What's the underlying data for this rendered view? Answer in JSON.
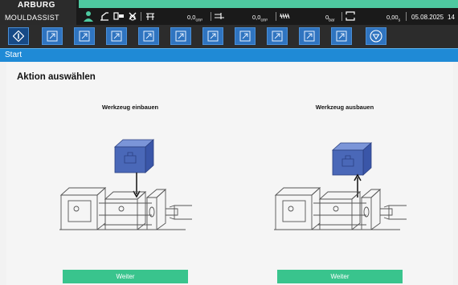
{
  "header": {
    "brand": "ARBURG",
    "app_name": "MOULDASSIST",
    "status": {
      "injection_volume": "0,0",
      "injection_unit": "cm³",
      "dosing_volume": "0,0",
      "dosing_unit": "cm³",
      "pressure": "0",
      "pressure_unit": "bar",
      "cycle_time": "0,00",
      "cycle_unit": "s",
      "date": "05.08.2025",
      "time": "14"
    },
    "status_icons": [
      "operator-icon",
      "robot-arm-icon",
      "door-icon",
      "no-alarm-icon",
      "tool-icon"
    ]
  },
  "toolbar": {
    "start_icon": "start-diamond-icon",
    "buttons": [
      "export-icon",
      "export-icon",
      "export-icon",
      "export-icon",
      "export-icon",
      "export-icon",
      "export-icon",
      "export-icon",
      "export-icon",
      "export-icon"
    ],
    "down_icon": "triangle-down-icon"
  },
  "breadcrumb": {
    "label": "Start"
  },
  "main": {
    "title": "Aktion auswählen",
    "options": [
      {
        "label": "Werkzeug einbauen",
        "button": "Weiter",
        "direction": "down"
      },
      {
        "label": "Werkzeug ausbauen",
        "button": "Weiter",
        "direction": "up"
      }
    ]
  },
  "colors": {
    "accent_green": "#39c48d",
    "status_green": "#4ec9a0",
    "toolbar_blue": "#2f74c0",
    "breadcrumb_blue": "#1f8ad6",
    "mould_blue": "#4a68b8"
  }
}
